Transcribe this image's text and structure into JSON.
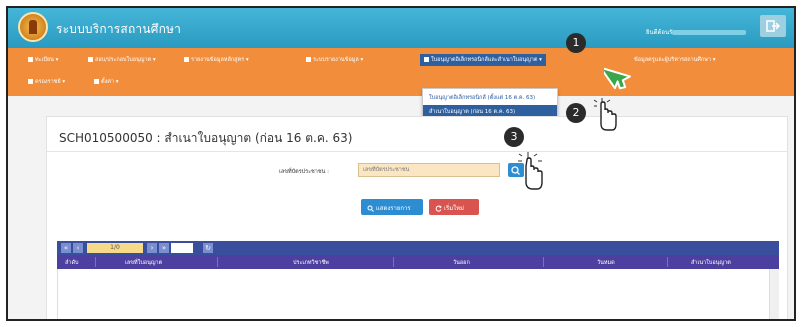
{
  "app": {
    "title": "ระบบบริการสถานศึกษา",
    "user_label": "ยินดีต้อนรับ"
  },
  "menu": {
    "items": [
      "ทะเบียน",
      "สอบ/ประกอบใบอนุญาต",
      "รายงานข้อมูลหลักสูตร",
      "ระบบรายงานข้อมูล",
      "ใบอนุญาตอิเล็กทรอนิกส์และสำเนาใบอนุญาต",
      "ข้อมูลครูและผู้บริหารสถานศึกษา",
      "ครองราชย์",
      "ตั้งค่า"
    ],
    "dropdown": [
      "ใบอนุญาตอิเล็กทรอนิกส์ (ตั้งแต่ 16 ต.ค. 63)",
      "สำเนาใบอนุญาต (ก่อน 16 ต.ค. 63)"
    ]
  },
  "steps": [
    "1",
    "2",
    "3"
  ],
  "page": {
    "title": "SCH010500050 : สำเนาใบอนุญาต (ก่อน 16 ต.ค. 63)",
    "field_label": "เลขที่บัตรประชาชน :",
    "input_placeholder": "เลขที่บัตรประชาชน",
    "show_button": "แสดงรายการ",
    "reset_button": "เริ่มใหม่"
  },
  "pager": {
    "page": "1/0"
  },
  "grid": {
    "columns": [
      "ลำดับ",
      "เลขที่ใบอนุญาต",
      "ประเภทวิชาชีพ",
      "วันออก",
      "วันหมด",
      "สำเนาใบอนุญาต"
    ]
  },
  "colors": {
    "topbar": "#2a9ac0",
    "menubar": "#f18d3b",
    "active_menu": "#2e5f9e",
    "grid_header": "#4b3fa0",
    "show_button": "#2d8dd2",
    "reset_button": "#d9534f",
    "cursor_green": "#3aa84a"
  },
  "icons": {
    "logo": "seal-logo-icon",
    "logout": "logout-icon",
    "search": "search-icon",
    "refresh": "refresh-icon",
    "cursor": "hand-cursor-icon",
    "arrow": "green-arrow-cursor-icon"
  }
}
